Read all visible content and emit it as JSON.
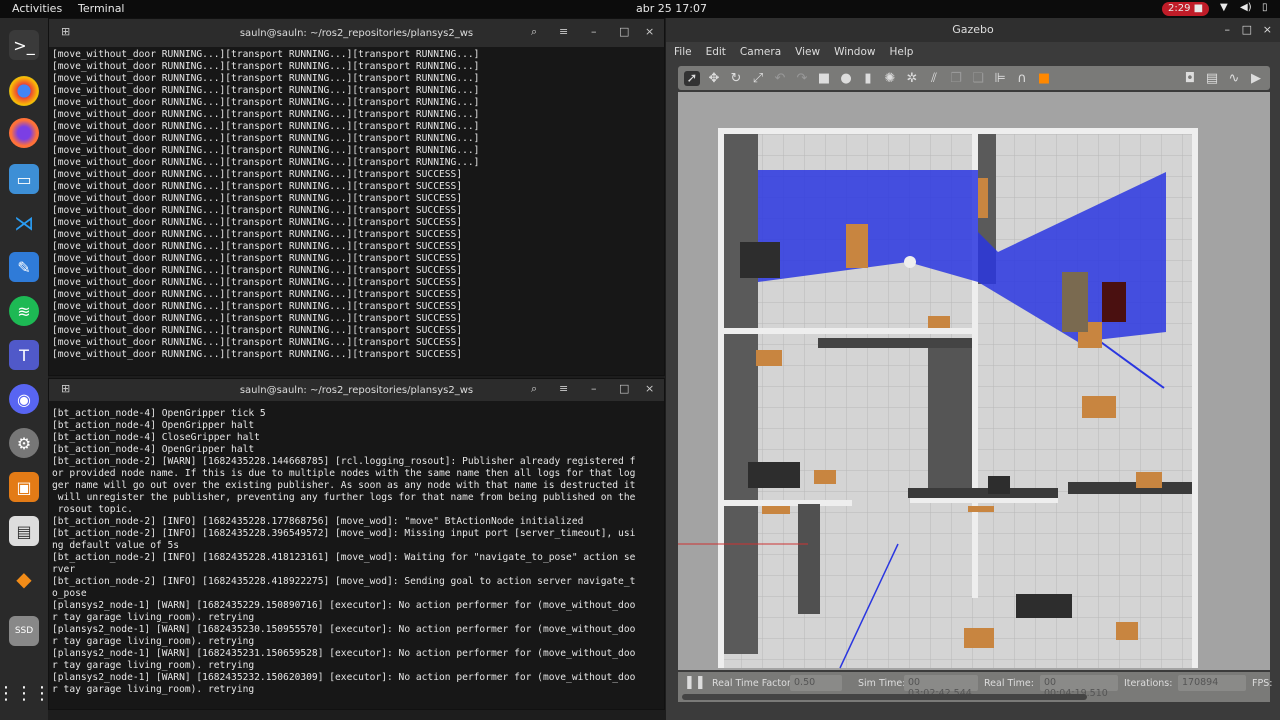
{
  "topbar": {
    "activities": "Activities",
    "app": "Terminal",
    "clock": "abr 25  17:07",
    "recording": "2:29"
  },
  "dock": [
    "terminal",
    "chrome",
    "firefox",
    "files",
    "vscode",
    "text-editor",
    "spotify",
    "teams",
    "discord",
    "settings",
    "screenshot",
    "document-viewer",
    "inkscape",
    "drive",
    "app-grid"
  ],
  "terminal1": {
    "title": "sauln@sauln: ~/ros2_repositories/plansys2_ws",
    "lines": [
      "[move_without_door RUNNING...][transport RUNNING...][transport RUNNING...]",
      "[move_without_door RUNNING...][transport RUNNING...][transport RUNNING...]",
      "[move_without_door RUNNING...][transport RUNNING...][transport RUNNING...]",
      "[move_without_door RUNNING...][transport RUNNING...][transport RUNNING...]",
      "[move_without_door RUNNING...][transport RUNNING...][transport RUNNING...]",
      "[move_without_door RUNNING...][transport RUNNING...][transport RUNNING...]",
      "[move_without_door RUNNING...][transport RUNNING...][transport RUNNING...]",
      "[move_without_door RUNNING...][transport RUNNING...][transport RUNNING...]",
      "[move_without_door RUNNING...][transport RUNNING...][transport RUNNING...]",
      "[move_without_door RUNNING...][transport RUNNING...][transport RUNNING...]",
      "[move_without_door RUNNING...][transport RUNNING...][transport SUCCESS]",
      "[move_without_door RUNNING...][transport RUNNING...][transport SUCCESS]",
      "[move_without_door RUNNING...][transport RUNNING...][transport SUCCESS]",
      "[move_without_door RUNNING...][transport RUNNING...][transport SUCCESS]",
      "[move_without_door RUNNING...][transport RUNNING...][transport SUCCESS]",
      "[move_without_door RUNNING...][transport RUNNING...][transport SUCCESS]",
      "[move_without_door RUNNING...][transport RUNNING...][transport SUCCESS]",
      "[move_without_door RUNNING...][transport RUNNING...][transport SUCCESS]",
      "[move_without_door RUNNING...][transport RUNNING...][transport SUCCESS]",
      "[move_without_door RUNNING...][transport RUNNING...][transport SUCCESS]",
      "[move_without_door RUNNING...][transport RUNNING...][transport SUCCESS]",
      "[move_without_door RUNNING...][transport RUNNING...][transport SUCCESS]",
      "[move_without_door RUNNING...][transport RUNNING...][transport SUCCESS]",
      "[move_without_door RUNNING...][transport RUNNING...][transport SUCCESS]",
      "[move_without_door RUNNING...][transport RUNNING...][transport SUCCESS]",
      "[move_without_door RUNNING...][transport RUNNING...][transport SUCCESS]"
    ]
  },
  "terminal2": {
    "title": "sauln@sauln: ~/ros2_repositories/plansys2_ws",
    "lines": [
      "[bt_action_node-4] OpenGripper tick 5",
      "[bt_action_node-4] OpenGripper halt",
      "[bt_action_node-4] CloseGripper halt",
      "[bt_action_node-4] OpenGripper halt",
      "[bt_action_node-2] [WARN] [1682435228.144668785] [rcl.logging_rosout]: Publisher already registered f",
      "or provided node name. If this is due to multiple nodes with the same name then all logs for that log",
      "ger name will go out over the existing publisher. As soon as any node with that name is destructed it",
      " will unregister the publisher, preventing any further logs for that name from being published on the",
      " rosout topic.",
      "[bt_action_node-2] [INFO] [1682435228.177868756] [move_wod]: \"move\" BtActionNode initialized",
      "[bt_action_node-2] [INFO] [1682435228.396549572] [move_wod]: Missing input port [server_timeout], usi",
      "ng default value of 5s",
      "[bt_action_node-2] [INFO] [1682435228.418123161] [move_wod]: Waiting for \"navigate_to_pose\" action se",
      "rver",
      "[bt_action_node-2] [INFO] [1682435228.418922275] [move_wod]: Sending goal to action server navigate_t",
      "o_pose",
      "[plansys2_node-1] [WARN] [1682435229.150890716] [executor]: No action performer for (move_without_doo",
      "r tay garage living_room). retrying",
      "[plansys2_node-1] [WARN] [1682435230.150955570] [executor]: No action performer for (move_without_doo",
      "r tay garage living_room). retrying",
      "[plansys2_node-1] [WARN] [1682435231.150659528] [executor]: No action performer for (move_without_doo",
      "r tay garage living_room). retrying",
      "[plansys2_node-1] [WARN] [1682435232.150620309] [executor]: No action performer for (move_without_doo",
      "r tay garage living_room). retrying"
    ]
  },
  "gazebo": {
    "title": "Gazebo",
    "menu": [
      "File",
      "Edit",
      "Camera",
      "View",
      "Window",
      "Help"
    ],
    "status": {
      "rtf_label": "Real Time Factor:",
      "rtf": "0.50",
      "sim_label": "Sim Time:",
      "sim": "00 03:02:42.544",
      "real_label": "Real Time:",
      "real": "00 00:04:19.510",
      "iter_label": "Iterations:",
      "iter": "170894",
      "fps_label": "FPS:"
    }
  }
}
